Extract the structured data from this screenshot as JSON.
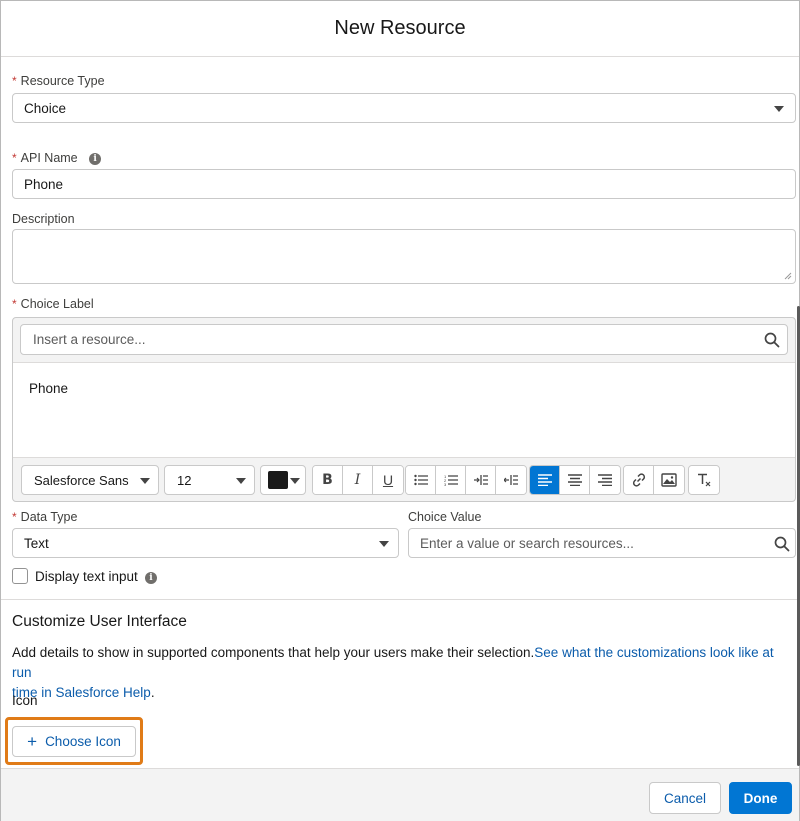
{
  "modal": {
    "title": "New Resource"
  },
  "resource_type": {
    "label": "Resource Type",
    "value": "Choice"
  },
  "api_name": {
    "label": "API Name",
    "value": "Phone"
  },
  "description": {
    "label": "Description",
    "value": ""
  },
  "choice_label": {
    "label": "Choice Label",
    "search_placeholder": "Insert a resource...",
    "content": "Phone",
    "font_family": "Salesforce Sans",
    "font_size": "12",
    "text_color": "#1a1a1a"
  },
  "data_type": {
    "label": "Data Type",
    "value": "Text"
  },
  "choice_value": {
    "label": "Choice Value",
    "placeholder": "Enter a value or search resources..."
  },
  "display_text_input": {
    "label": "Display text input",
    "checked": false
  },
  "customize": {
    "heading": "Customize User Interface",
    "description": "Add details to show in supported components that help your users make their selection.",
    "link_text_line1": "See what the customizations look like at run",
    "link_text_line2": "time in Salesforce Help",
    "period": ".",
    "icon_label": "Icon",
    "choose_icon_button": "Choose Icon"
  },
  "footer": {
    "cancel_label": "Cancel",
    "done_label": "Done"
  },
  "colors": {
    "brand": "#0176d3",
    "highlight": "#e07b17",
    "required": "#c23934"
  }
}
